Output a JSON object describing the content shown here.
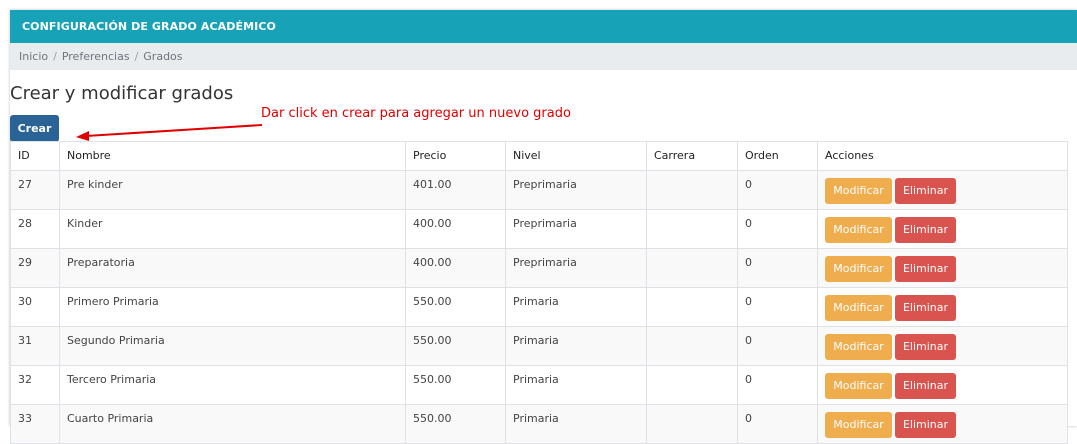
{
  "header": {
    "title": "CONFIGURACIÓN DE GRADO ACADÉMICO"
  },
  "breadcrumb": {
    "items": [
      "Inicio",
      "Preferencias",
      "Grados"
    ]
  },
  "page": {
    "heading": "Crear y modificar grados",
    "create_label": "Crear",
    "annotation": "Dar click en crear para agregar un nuevo grado"
  },
  "table": {
    "columns": [
      "ID",
      "Nombre",
      "Precio",
      "Nivel",
      "Carrera",
      "Orden",
      "Acciones"
    ],
    "rows": [
      {
        "id": "27",
        "nombre": "Pre kinder",
        "precio": "401.00",
        "nivel": "Preprimaria",
        "carrera": "",
        "orden": "0"
      },
      {
        "id": "28",
        "nombre": "Kinder",
        "precio": "400.00",
        "nivel": "Preprimaria",
        "carrera": "",
        "orden": "0"
      },
      {
        "id": "29",
        "nombre": "Preparatoria",
        "precio": "400.00",
        "nivel": "Preprimaria",
        "carrera": "",
        "orden": "0"
      },
      {
        "id": "30",
        "nombre": "Primero Primaria",
        "precio": "550.00",
        "nivel": "Primaria",
        "carrera": "",
        "orden": "0"
      },
      {
        "id": "31",
        "nombre": "Segundo Primaria",
        "precio": "550.00",
        "nivel": "Primaria",
        "carrera": "",
        "orden": "0"
      },
      {
        "id": "32",
        "nombre": "Tercero Primaria",
        "precio": "550.00",
        "nivel": "Primaria",
        "carrera": "",
        "orden": "0"
      },
      {
        "id": "33",
        "nombre": "Cuarto Primaria",
        "precio": "550.00",
        "nivel": "Primaria",
        "carrera": "",
        "orden": "0"
      }
    ],
    "modify_label": "Modificar",
    "delete_label": "Eliminar"
  },
  "colors": {
    "topbar": "#17a2b8",
    "create_button": "#2a6496",
    "modify_button": "#f0ad4e",
    "delete_button": "#d9534f",
    "annotation": "#e00000"
  }
}
